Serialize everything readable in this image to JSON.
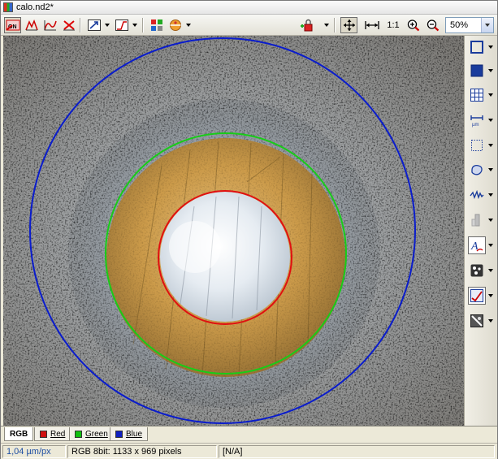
{
  "window": {
    "title": "calo.nd2*"
  },
  "toolbar": {
    "buttons": [
      {
        "icon": "on-switch-icon",
        "active": true
      },
      {
        "icon": "histogram-curve-icon"
      },
      {
        "icon": "lut-curve-icon"
      },
      {
        "icon": "reset-lut-icon"
      },
      {
        "icon": "auto-contrast-icon"
      },
      {
        "icon": "gamma-curve-icon"
      },
      {
        "icon": "color-channels-icon"
      },
      {
        "icon": "overlay-palette-icon"
      },
      {
        "icon": "lock-layer-icon"
      },
      {
        "icon": "fit-to-window-icon"
      },
      {
        "icon": "fit-width-icon"
      },
      {
        "icon": "zoom-in-icon"
      },
      {
        "icon": "zoom-out-icon"
      }
    ],
    "ratio_label": "1:1",
    "zoom": "50%"
  },
  "image": {
    "description_colors": {
      "outer_circle": "#0000d0",
      "middle_circle": "#00d000",
      "inner_circle": "#e00000"
    }
  },
  "sidebar": {
    "tools": [
      {
        "icon": "rectangle-outline-icon"
      },
      {
        "icon": "rectangle-filled-icon"
      },
      {
        "icon": "grid-icon"
      },
      {
        "icon": "scale-bar-icon"
      },
      {
        "icon": "dotted-rectangle-selection-icon"
      },
      {
        "icon": "freehand-selection-icon"
      },
      {
        "icon": "line-profile-icon"
      },
      {
        "icon": "bar-measure-icon"
      },
      {
        "icon": "text-annotation-icon",
        "active": true
      },
      {
        "icon": "binary-layer-icon"
      },
      {
        "icon": "measurement-layer-icon",
        "active": true
      },
      {
        "icon": "mask-layer-icon"
      }
    ]
  },
  "tabs": [
    {
      "label": "RGB",
      "active": true
    },
    {
      "label": "Red",
      "color": "#d01010"
    },
    {
      "label": "Green",
      "color": "#10c010"
    },
    {
      "label": "Blue",
      "color": "#1020c0"
    }
  ],
  "status": {
    "calibration": "1,04 µm/px",
    "info": "RGB 8bit: 1133 x 969 pixels",
    "extra": "[N/A]"
  }
}
